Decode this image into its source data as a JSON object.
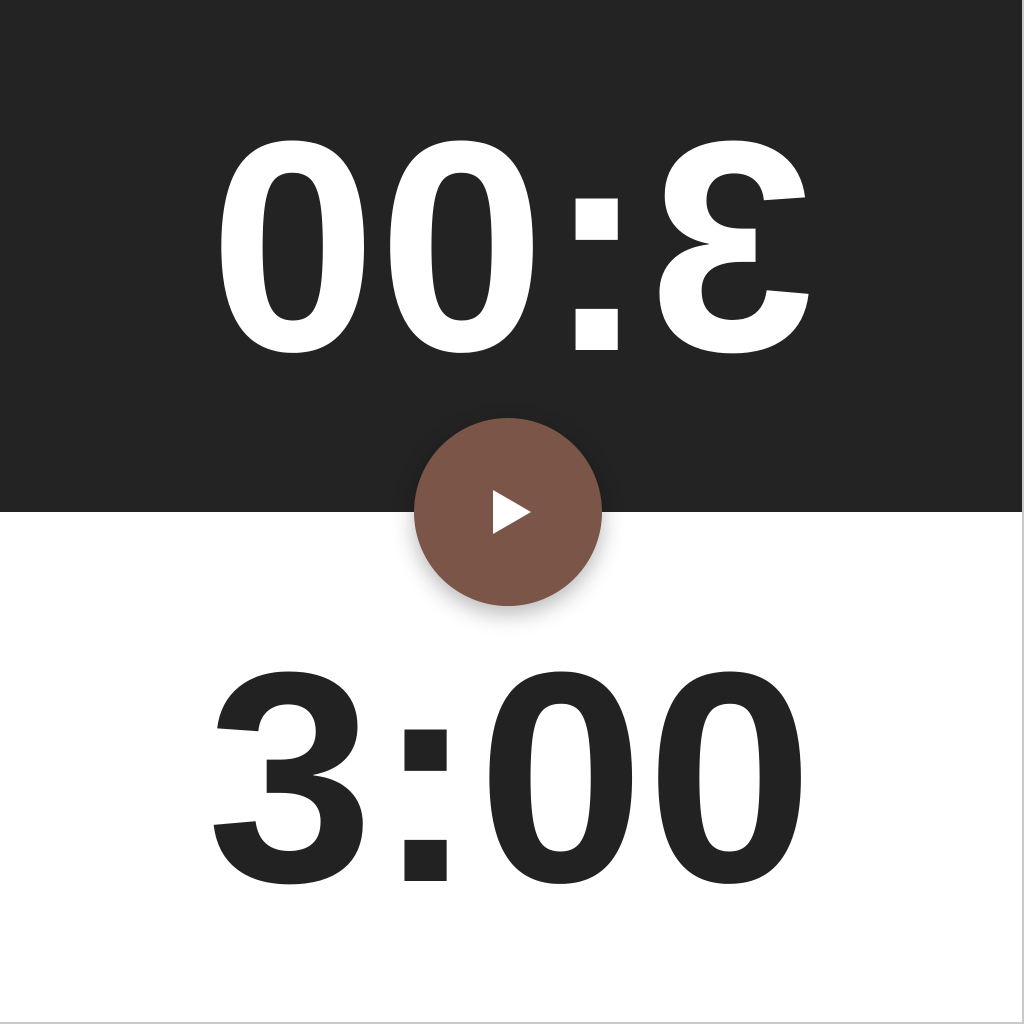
{
  "timer": {
    "top_player_time": "3:00",
    "bottom_player_time": "3:00"
  },
  "controls": {
    "play_icon": "play-icon",
    "accent_color": "#7a5548"
  },
  "colors": {
    "top_panel": "#232323",
    "bottom_panel": "#ffffff",
    "top_text": "#ffffff",
    "bottom_text": "#222222"
  }
}
